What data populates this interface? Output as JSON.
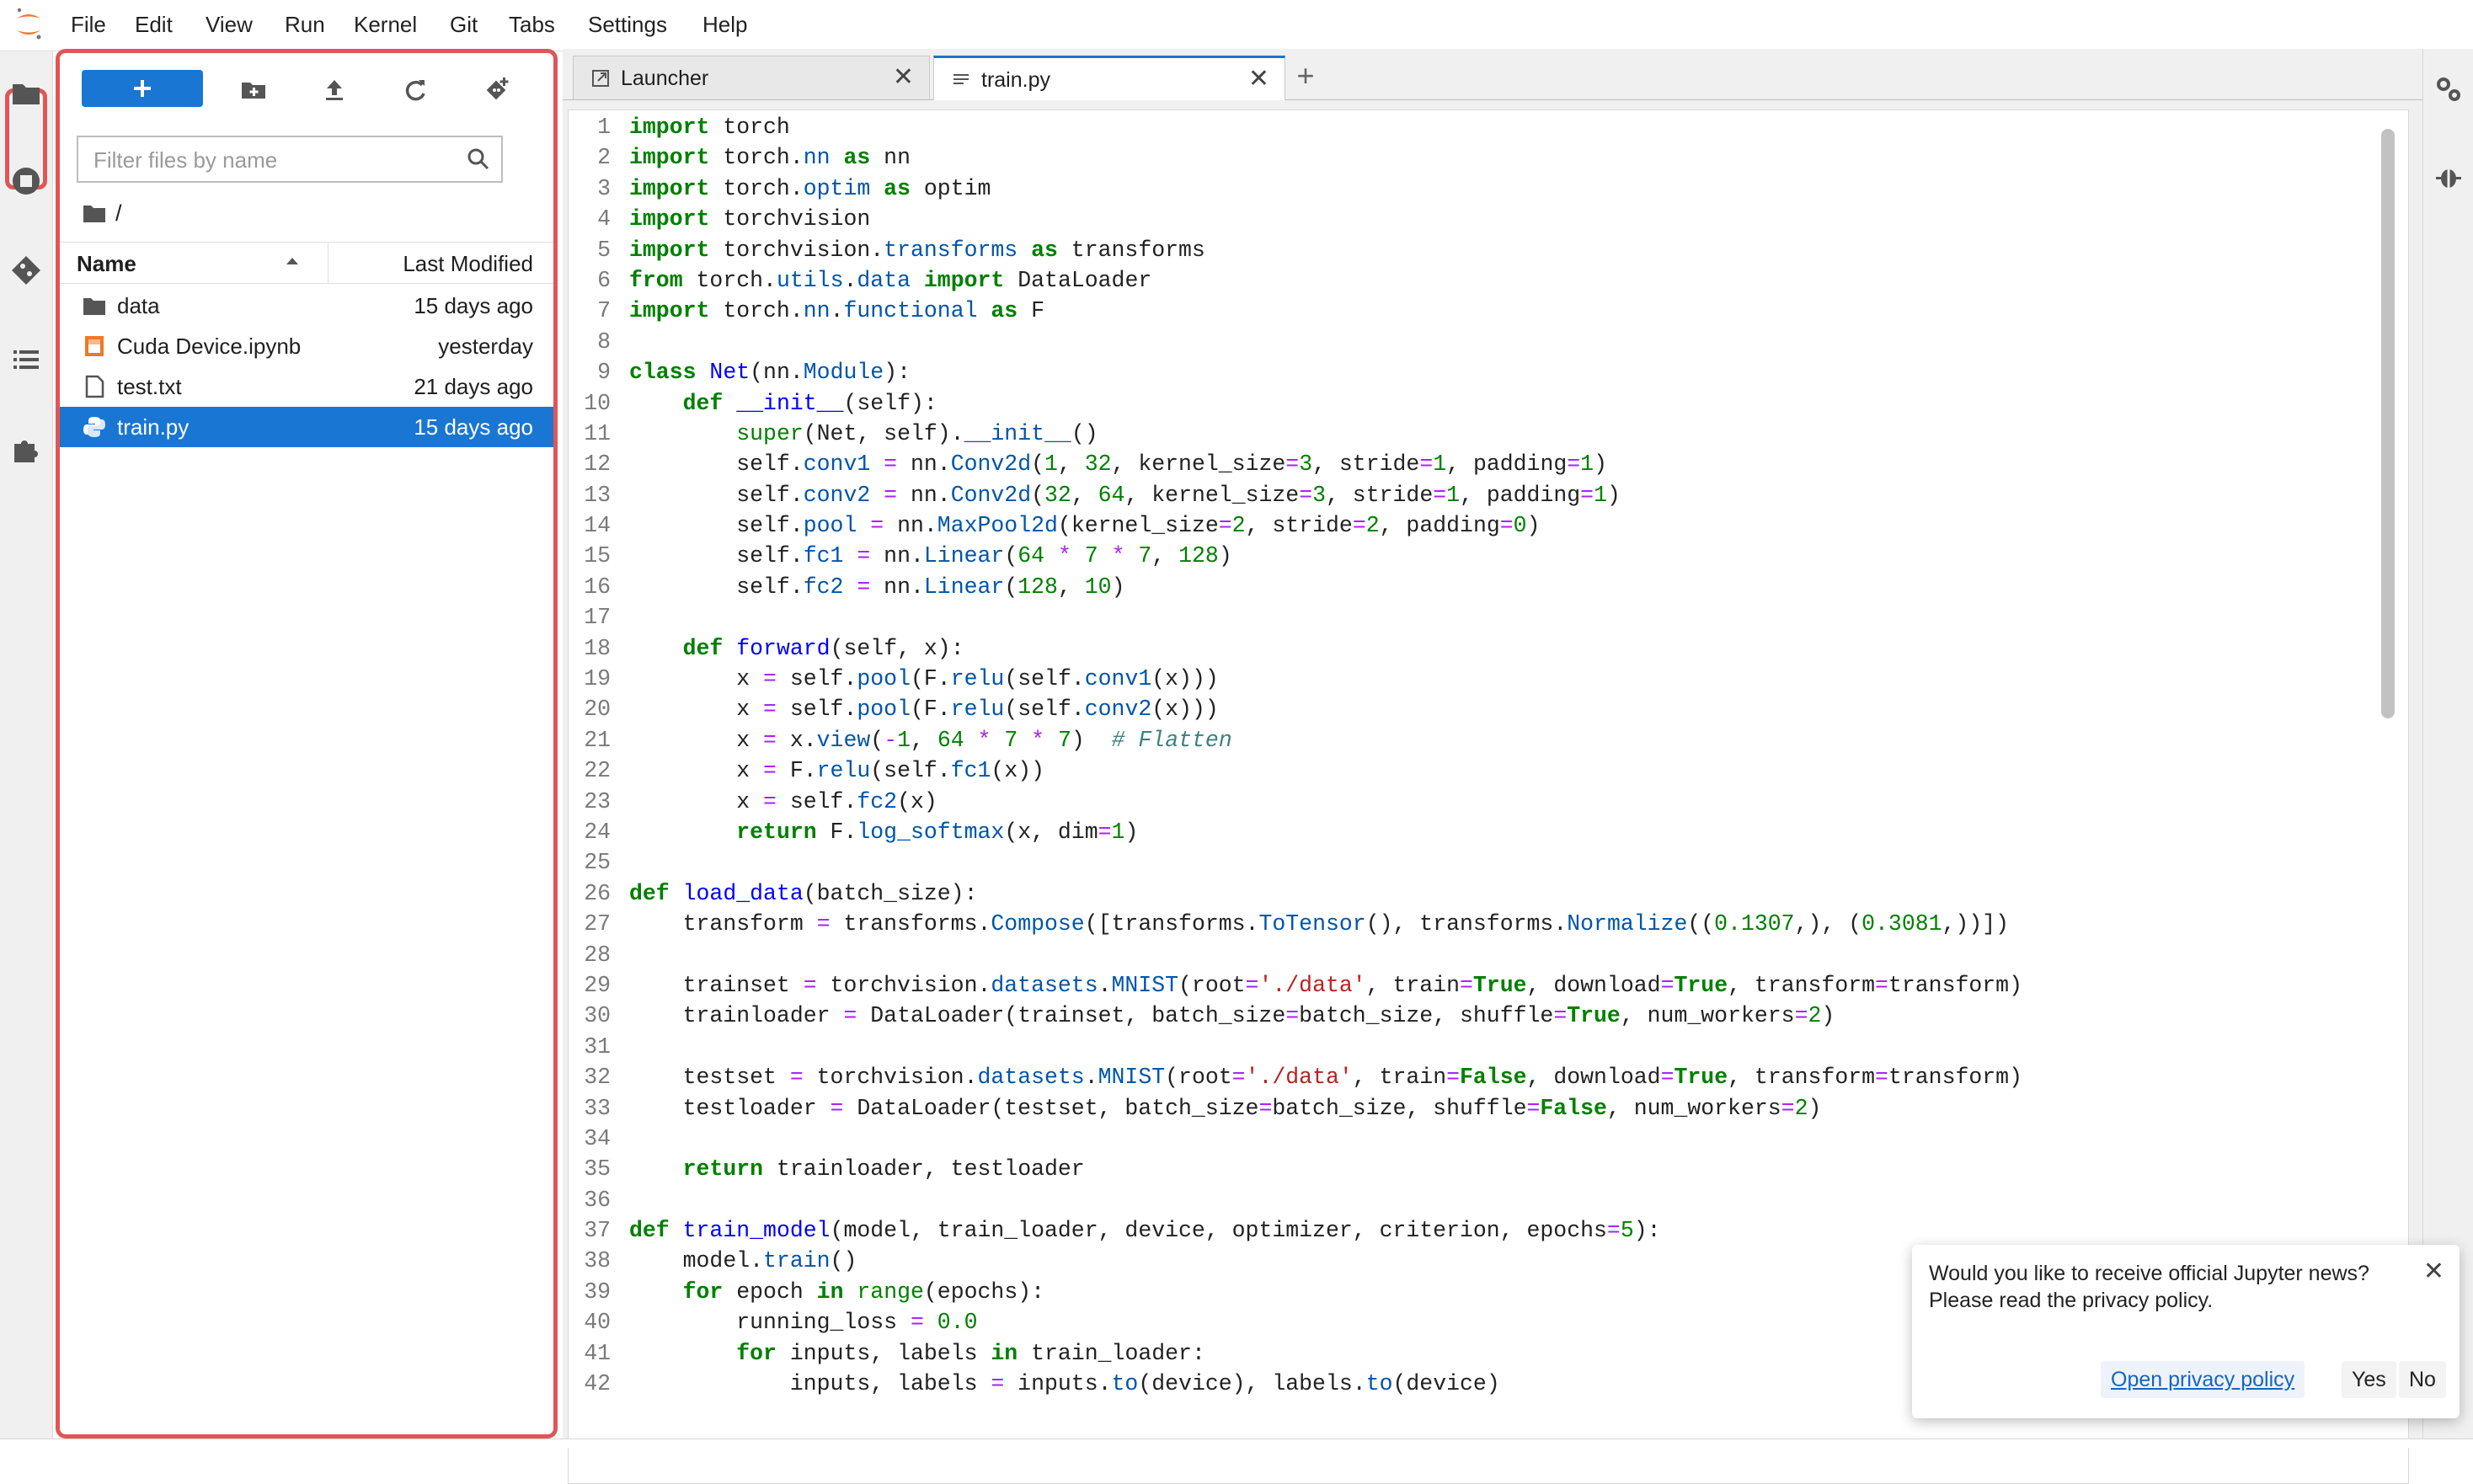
{
  "menubar": {
    "items": [
      "File",
      "Edit",
      "View",
      "Run",
      "Kernel",
      "Git",
      "Tabs",
      "Settings",
      "Help"
    ]
  },
  "activitybar": {
    "icons": [
      "folder-icon",
      "running-icon",
      "git-icon",
      "toc-icon",
      "extension-icon"
    ]
  },
  "filebrowser": {
    "filter_placeholder": "Filter files by name",
    "breadcrumb": "/",
    "columns": {
      "name": "Name",
      "modified": "Last Modified"
    },
    "files": [
      {
        "name": "data",
        "modified": "15 days ago",
        "icon": "folder-icon"
      },
      {
        "name": "Cuda Device.ipynb",
        "modified": "yesterday",
        "icon": "notebook-icon"
      },
      {
        "name": "test.txt",
        "modified": "21 days ago",
        "icon": "text-file-icon"
      },
      {
        "name": "train.py",
        "modified": "15 days ago",
        "icon": "python-icon",
        "selected": true
      }
    ]
  },
  "tabs": [
    {
      "label": "Launcher",
      "active": false
    },
    {
      "label": "train.py",
      "active": true
    }
  ],
  "editor": {
    "lines": [
      "import torch",
      "import torch.nn as nn",
      "import torch.optim as optim",
      "import torchvision",
      "import torchvision.transforms as transforms",
      "from torch.utils.data import DataLoader",
      "import torch.nn.functional as F",
      "",
      "class Net(nn.Module):",
      "    def __init__(self):",
      "        super(Net, self).__init__()",
      "        self.conv1 = nn.Conv2d(1, 32, kernel_size=3, stride=1, padding=1)",
      "        self.conv2 = nn.Conv2d(32, 64, kernel_size=3, stride=1, padding=1)",
      "        self.pool = nn.MaxPool2d(kernel_size=2, stride=2, padding=0)",
      "        self.fc1 = nn.Linear(64 * 7 * 7, 128)",
      "        self.fc2 = nn.Linear(128, 10)",
      "",
      "    def forward(self, x):",
      "        x = self.pool(F.relu(self.conv1(x)))",
      "        x = self.pool(F.relu(self.conv2(x)))",
      "        x = x.view(-1, 64 * 7 * 7)  # Flatten",
      "        x = F.relu(self.fc1(x))",
      "        x = self.fc2(x)",
      "        return F.log_softmax(x, dim=1)",
      "",
      "def load_data(batch_size):",
      "    transform = transforms.Compose([transforms.ToTensor(), transforms.Normalize((0.1307,), (0.3081,))])",
      "",
      "    trainset = torchvision.datasets.MNIST(root='./data', train=True, download=True, transform=transform)",
      "    trainloader = DataLoader(trainset, batch_size=batch_size, shuffle=True, num_workers=2)",
      "",
      "    testset = torchvision.datasets.MNIST(root='./data', train=False, download=True, transform=transform)",
      "    testloader = DataLoader(testset, batch_size=batch_size, shuffle=False, num_workers=2)",
      "",
      "    return trainloader, testloader",
      "",
      "def train_model(model, train_loader, device, optimizer, criterion, epochs=5):",
      "    model.train()",
      "    for epoch in range(epochs):",
      "        running_loss = 0.0",
      "        for inputs, labels in train_loader:",
      "            inputs, labels = inputs.to(device), labels.to(device)"
    ]
  },
  "notification": {
    "message_line1": "Would you like to receive official Jupyter news?",
    "message_line2": "Please read the privacy policy.",
    "link_label": "Open privacy policy",
    "yes_label": "Yes",
    "no_label": "No"
  },
  "colors": {
    "accent": "#1976d2",
    "highlight": "#e05656"
  }
}
